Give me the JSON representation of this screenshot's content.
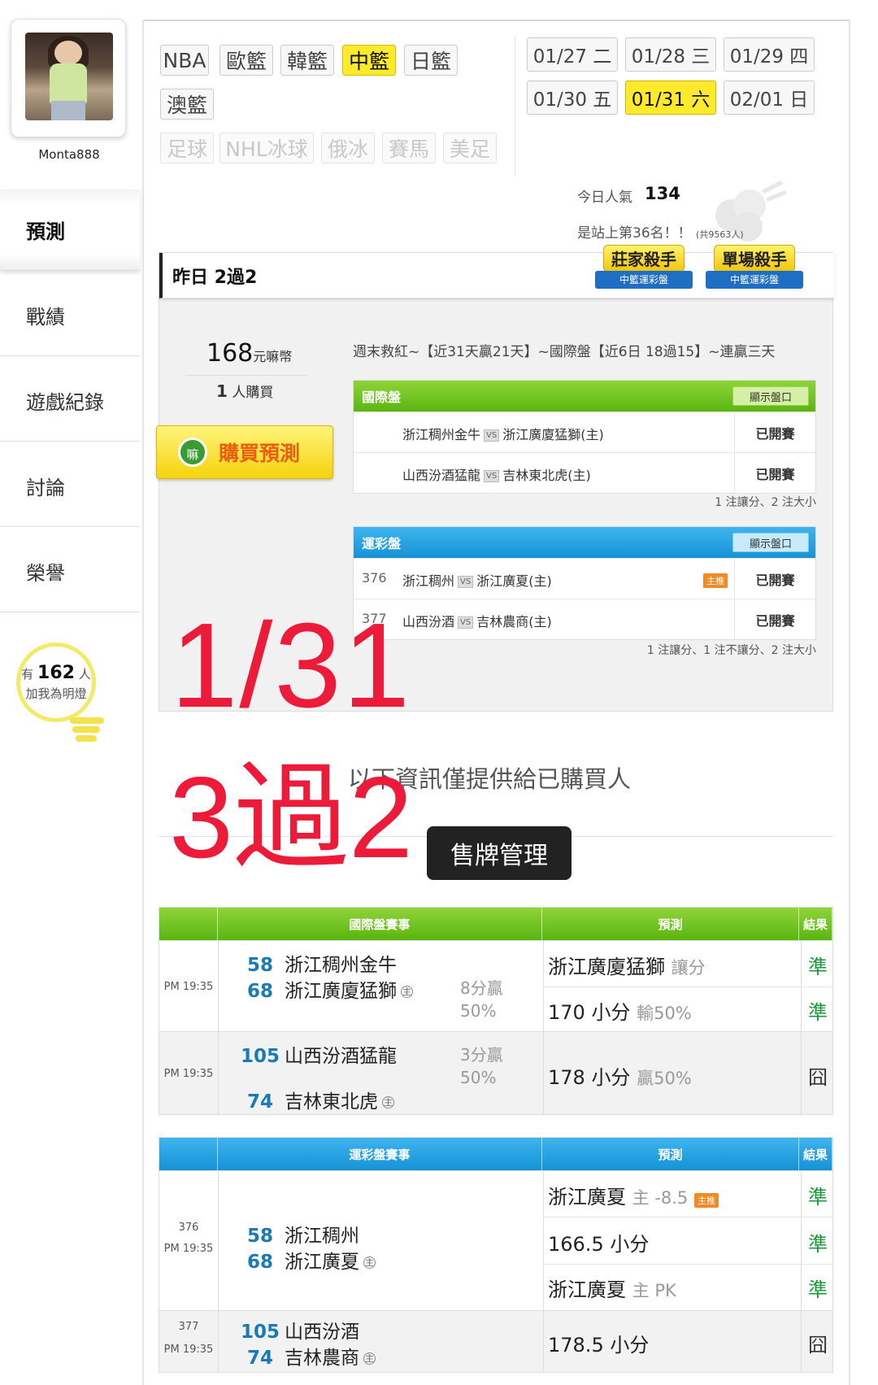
{
  "user": {
    "name": "Monta888"
  },
  "sidebar": {
    "items": [
      {
        "label": "預測"
      },
      {
        "label": "戰績"
      },
      {
        "label": "遊戲紀錄"
      },
      {
        "label": "討論"
      },
      {
        "label": "榮譽"
      }
    ]
  },
  "fans": {
    "prefix": "有",
    "count": "162",
    "unit": "人",
    "text": "加我為明燈"
  },
  "leagues": {
    "row1": [
      "NBA",
      "歐籃",
      "韓籃",
      "中籃",
      "日籃"
    ],
    "row2": [
      "澳籃"
    ],
    "row3": [
      "足球",
      "NHL冰球",
      "俄冰",
      "賽馬",
      "美足"
    ],
    "selected": "中籃"
  },
  "dates": [
    {
      "label": "01/27 二"
    },
    {
      "label": "01/28 三"
    },
    {
      "label": "01/29 四"
    },
    {
      "label": "01/30 五"
    },
    {
      "label": "01/31 六"
    },
    {
      "label": "02/01 日"
    }
  ],
  "popularity": {
    "label": "今日人氣",
    "value": "134",
    "rank_text": "是站上第36名！！",
    "rank_total": "(共9563人)"
  },
  "yesterday": {
    "title": "昨日 2過2",
    "badge1": {
      "title": "莊家殺手",
      "ribbon": "中籃運彩盤"
    },
    "badge2": {
      "title": "單場殺手",
      "ribbon": "中籃運彩盤"
    },
    "price": "168",
    "price_unit": "元嘛幣",
    "buyers_count": "1",
    "buyers_label": "人購買",
    "buy_button": "購買預測",
    "buy_icon": "嘛",
    "description": "週末救紅~【近31天贏21天】~國際盤【近6日 18過15】~連贏三天",
    "intl": {
      "title": "國際盤",
      "show_label": "顯示盤口",
      "rows": [
        {
          "away": "浙江稠州金牛",
          "vs": "VS",
          "home": "浙江廣廈猛獅(主)",
          "status": "已開賽"
        },
        {
          "away": "山西汾酒猛龍",
          "vs": "VS",
          "home": "吉林東北虎(主)",
          "status": "已開賽"
        }
      ],
      "note": "1 注讓分、2 注大小"
    },
    "lottery": {
      "title": "運彩盤",
      "show_label": "顯示盤口",
      "rows": [
        {
          "no": "376",
          "away": "浙江稠州",
          "vs": "VS",
          "home": "浙江廣夏(主)",
          "tag": "主推",
          "status": "已開賽"
        },
        {
          "no": "377",
          "away": "山西汾酒",
          "vs": "VS",
          "home": "吉林農商(主)",
          "tag": "",
          "status": "已開賽"
        }
      ],
      "note": "1 注讓分、1 注不讓分、2 注大小"
    }
  },
  "overlay": {
    "date": "1/31",
    "result": "3過2"
  },
  "info_text": "以下資訊僅提供給已購買人",
  "management_button": "售牌管理",
  "results": {
    "intl": {
      "headers": [
        "",
        "國際盤賽事",
        "預測",
        "結果"
      ],
      "games": [
        {
          "time": "PM 19:35",
          "away_score": "58",
          "away": "浙江稠州金牛",
          "home_score": "68",
          "home": "浙江廣廈猛獅",
          "home_mark": "主",
          "margin1": "8分贏",
          "margin2": "50%",
          "picks": [
            {
              "main": "浙江廣廈猛獅",
              "sub": "讓分",
              "result": "準"
            },
            {
              "main": "170 小分",
              "sub": "輸50%",
              "result": "準"
            }
          ]
        },
        {
          "time": "PM 19:35",
          "away_score": "105",
          "away": "山西汾酒猛龍",
          "home_score": "74",
          "home": "吉林東北虎",
          "home_mark": "主",
          "margin1": "3分贏",
          "margin2": "50%",
          "picks": [
            {
              "main": "178 小分",
              "sub": "贏50%",
              "result": "囧"
            }
          ]
        }
      ]
    },
    "lottery": {
      "headers": [
        "",
        "運彩盤賽事",
        "預測",
        "結果"
      ],
      "games": [
        {
          "no": "376",
          "time": "PM 19:35",
          "away_score": "58",
          "away": "浙江稠州",
          "home_score": "68",
          "home": "浙江廣夏",
          "home_mark": "主",
          "picks": [
            {
              "main": "浙江廣夏",
              "sub": "主 -8.5",
              "tag": "主推",
              "result": "準"
            },
            {
              "main": "166.5 小分",
              "sub": "",
              "result": "準"
            },
            {
              "main": "浙江廣夏",
              "sub": "主 PK",
              "result": "準"
            }
          ]
        },
        {
          "no": "377",
          "time": "PM 19:35",
          "away_score": "105",
          "away": "山西汾酒",
          "home_score": "74",
          "home": "吉林農商",
          "home_mark": "主",
          "picks": [
            {
              "main": "178.5 小分",
              "sub": "",
              "result": "囧"
            }
          ]
        }
      ]
    }
  }
}
